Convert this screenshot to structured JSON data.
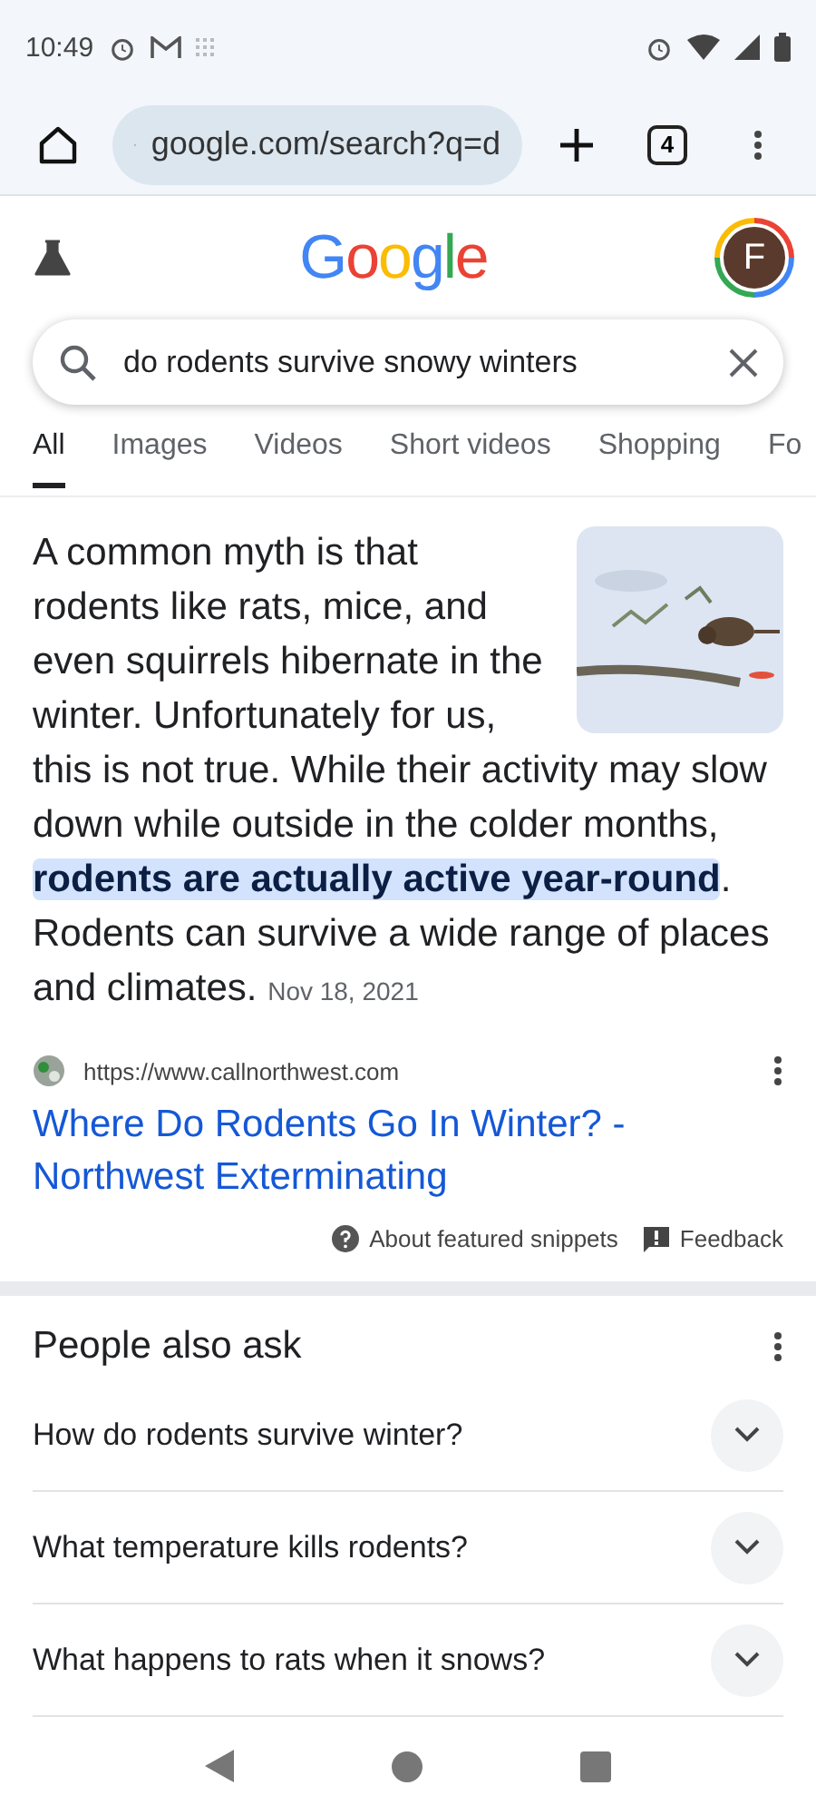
{
  "status_bar": {
    "time": "10:49"
  },
  "browser": {
    "url": "google.com/search?q=d",
    "tab_count": "4"
  },
  "header": {
    "logo": "Google",
    "avatar": "F"
  },
  "search": {
    "value": "do rodents survive snowy winters"
  },
  "tabs": [
    {
      "label": "All",
      "selected": true
    },
    {
      "label": "Images",
      "selected": false
    },
    {
      "label": "Videos",
      "selected": false
    },
    {
      "label": "Short videos",
      "selected": false
    },
    {
      "label": "Shopping",
      "selected": false
    },
    {
      "label": "Fo",
      "selected": false
    }
  ],
  "snippet": {
    "text_before": "A common myth is that rodents like rats, mice, and even squirrels hibernate in the winter. Unfortunately for us, this is not true. While their activity may slow down while outside in the colder months, ",
    "highlight": "rodents are actually active year-round",
    "text_after": ". Rodents can survive a wide range of places and climates.",
    "date": "Nov 18, 2021"
  },
  "source": {
    "url": "https://www.callnorthwest.com",
    "title": "Where Do Rodents Go In Winter? - Northwest Exterminating"
  },
  "snippet_footer": {
    "about": "About featured snippets",
    "feedback": "Feedback"
  },
  "people_also_ask": {
    "title": "People also ask",
    "questions": [
      {
        "text": "How do rodents survive winter?",
        "expanded": false
      },
      {
        "text": "What temperature kills rodents?",
        "expanded": false
      },
      {
        "text": "What happens to rats when it snows?",
        "expanded": false
      }
    ]
  }
}
